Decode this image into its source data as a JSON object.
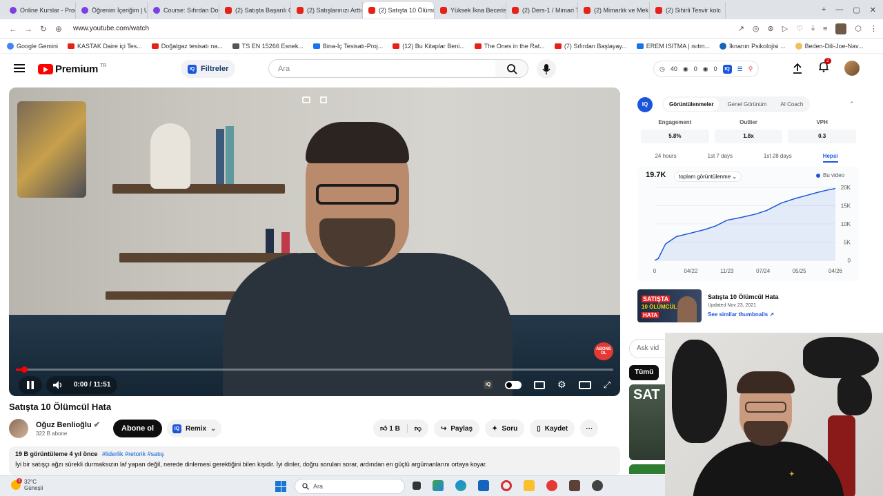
{
  "browser": {
    "tabs": [
      {
        "label": "Online Kurslar - Proc",
        "icon": "udemy"
      },
      {
        "label": "Öğrenim İçeriğim | U",
        "icon": "udemy"
      },
      {
        "label": "Course: Sıfırdan Doğ",
        "icon": "udemy"
      },
      {
        "label": "(2) Satışta Başarılı Ol",
        "icon": "youtube"
      },
      {
        "label": "(2) Satışlarınızı Arttır",
        "icon": "youtube"
      },
      {
        "label": "(2) Satışta 10 Ölümcül",
        "icon": "youtube",
        "active": true
      },
      {
        "label": "Yüksek İkna Becerisi",
        "icon": "youtube"
      },
      {
        "label": "(2) Ders-1 / Mimari T",
        "icon": "youtube"
      },
      {
        "label": "(2) Mimarlık ve Mek",
        "icon": "youtube"
      },
      {
        "label": "(2) Sihirli Tesvir kolc",
        "icon": "youtube"
      }
    ],
    "url": "www.youtube.com/watch",
    "bookmarks": [
      {
        "label": "Google Gemini",
        "icon": "g"
      },
      {
        "label": "KASTAK Daire içi Tes...",
        "icon": "yt"
      },
      {
        "label": "Doğalgaz tesisatı na...",
        "icon": "yt"
      },
      {
        "label": "TS EN 15266 Esnek...",
        "icon": "doc"
      },
      {
        "label": "Bina-İç Tesisatı-Proj...",
        "icon": "blue"
      },
      {
        "label": "(12) Bu Kitaplar Beni...",
        "icon": "yt"
      },
      {
        "label": "The Ones in the Rat...",
        "icon": "yt"
      },
      {
        "label": "(7) Sıfırdan Başlayay...",
        "icon": "yt"
      },
      {
        "label": "EREM ISITMA | ısıtm...",
        "icon": "blue"
      },
      {
        "label": "İknanın Psikolojisi ...",
        "icon": "ok"
      },
      {
        "label": "Beden-Dili-Joe-Nav...",
        "icon": "face"
      }
    ]
  },
  "yt": {
    "logo_text": "Premium",
    "logo_tr": "TR",
    "filters_label": "Filtreler",
    "search_placeholder": "Ara",
    "stats": {
      "watch": "40",
      "eye1": "0",
      "eye2": "0"
    },
    "notif_count": "2"
  },
  "video": {
    "title": "Satışta 10 Ölümcül Hata",
    "time": "0:00 / 11:51",
    "progress_fraction": 0.01,
    "abone_badge": "ABONE OL",
    "channel": "Oğuz Benlioğlu",
    "subscribers": "322 B abone",
    "subscribe_label": "Abone ol",
    "remix_label": "Remix",
    "like_count": "1 B",
    "share_label": "Paylaş",
    "ask_label": "Soru",
    "save_label": "Kaydet",
    "views_meta": "19 B görüntüleme  4 yıl önce",
    "tags": "#liderlik #retorik #satış",
    "description": "İyi bir satışçı ağzı sürekli durmaksızın laf yapan değil, nerede dinlemesi gerektiğini bilen kişidir. İyi dinler, doğru soruları sorar, ardından en güçlü argümanlarını ortaya koyar."
  },
  "iq": {
    "tabs": [
      "Görüntülenmeler",
      "Genel Görünüm",
      "AI Coach"
    ],
    "metrics": [
      {
        "label": "Engagement",
        "value": "5.8%"
      },
      {
        "label": "Outlier",
        "value": "1.8x"
      },
      {
        "label": "VPH",
        "value": "0.3"
      }
    ],
    "ranges": [
      "24 hours",
      "1st 7 days",
      "1st 28 days",
      "Hepsi"
    ],
    "total": "19.7K",
    "select_label": "toplam görüntülenme",
    "legend": "Bu video"
  },
  "chart_data": {
    "type": "area",
    "title": "",
    "x_ticks": [
      "0",
      "04/22",
      "11/23",
      "07/24",
      "05/25",
      "04/26"
    ],
    "y_ticks": [
      "0",
      "5K",
      "10K",
      "15K",
      "20K"
    ],
    "ylim": [
      0,
      20000
    ],
    "series": [
      {
        "name": "Bu video",
        "x": [
          0,
          0.02,
          0.06,
          0.12,
          0.2,
          0.28,
          0.34,
          0.4,
          0.48,
          0.56,
          0.62,
          0.7,
          0.78,
          0.84,
          0.9,
          0.95,
          1.0
        ],
        "values": [
          0,
          500,
          4500,
          6500,
          7500,
          8500,
          9500,
          11000,
          11800,
          12700,
          13700,
          15700,
          17000,
          17800,
          18600,
          19200,
          19700
        ]
      }
    ]
  },
  "thumbcard": {
    "line1": "SATIŞTA",
    "line2": "10 ÖLÜMCÜL",
    "line3": "HATA",
    "title": "Satışta 10 Ölümcül Hata",
    "date": "Updated Nov 23, 2021",
    "link": "See similar thumbnails ↗"
  },
  "sidebar": {
    "ask_placeholder": "Ask vid",
    "chip_all": "Tümü",
    "rec_text": "SAT"
  },
  "taskbar": {
    "temp": "32°C",
    "weather": "Güneşli",
    "weather_badge": "1",
    "search": "Ara"
  },
  "colors": {
    "accent": "#1a56db",
    "youtube_red": "#ff0000"
  }
}
